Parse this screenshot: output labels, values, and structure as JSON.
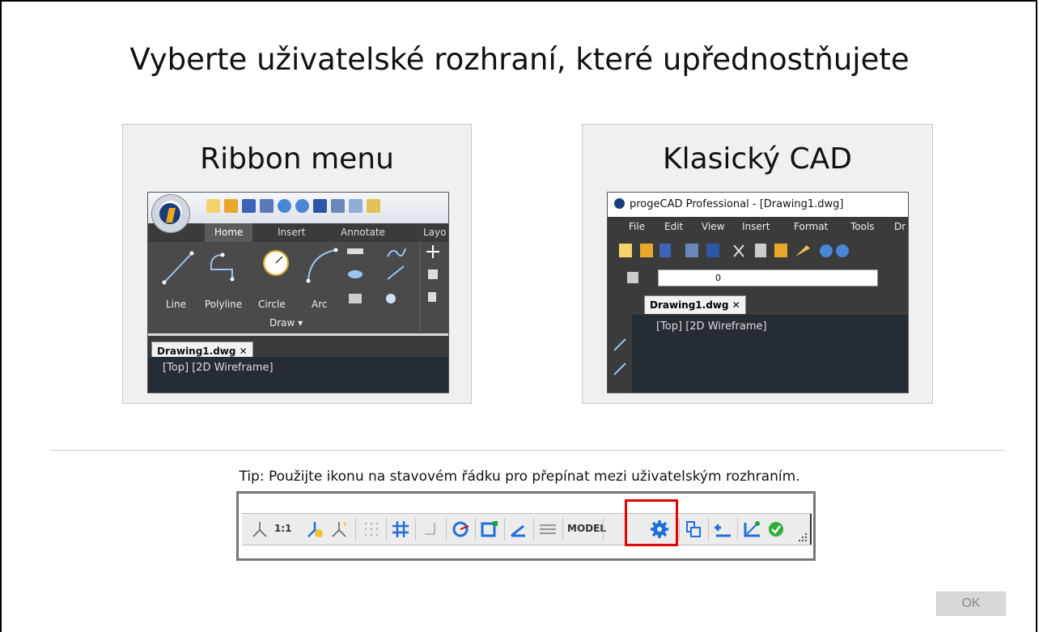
{
  "heading": "Vyberte uživatelské rozhraní, které upřednostňujete",
  "options": {
    "ribbon": {
      "title": "Ribbon menu",
      "preview": {
        "tabs": [
          "Home",
          "Insert",
          "Annotate",
          "Layo"
        ],
        "tools": [
          "Line",
          "Polyline",
          "Circle",
          "Arc"
        ],
        "panel_label": "Draw ▾",
        "doc_tab": "Drawing1.dwg",
        "viewport_label": "[Top] [2D Wireframe]"
      }
    },
    "classic": {
      "title": "Klasický CAD",
      "preview": {
        "window_title": "progeCAD Professional - [Drawing1.dwg]",
        "menu": [
          "File",
          "Edit",
          "View",
          "Insert",
          "Format",
          "Tools",
          "Dr"
        ],
        "layer_value": "0",
        "doc_tab": "Drawing1.dwg",
        "viewport_label": "[Top] [2D Wireframe]"
      }
    }
  },
  "tip": "Tip: Použijte ikonu na stavovém řádku pro přepínat mezi uživatelským rozhraním.",
  "statusbar": {
    "scale": "1:1",
    "model": "MODEL"
  },
  "colors": {
    "highlight": "#e00000",
    "icon_blue": "#1f6fd8"
  },
  "ok_button": "OK"
}
